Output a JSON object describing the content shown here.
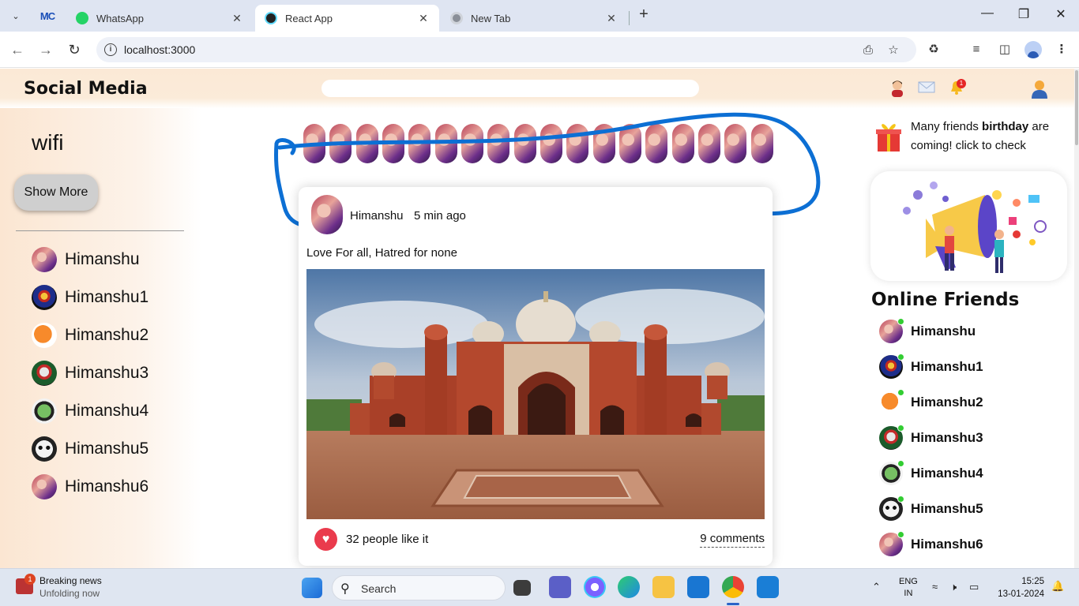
{
  "browser": {
    "tabs": [
      {
        "title": "WhatsApp",
        "active": false
      },
      {
        "title": "React App",
        "active": true
      },
      {
        "title": "New Tab",
        "active": false
      }
    ],
    "address": "localhost:3000"
  },
  "app": {
    "brand": "Social Media",
    "notification_count": "1",
    "left": {
      "heading": "wifi",
      "show_more": "Show More",
      "friends": [
        "Himanshu",
        "Himanshu1",
        "Himanshu2",
        "Himanshu3",
        "Himanshu4",
        "Himanshu5",
        "Himanshu6"
      ]
    },
    "post": {
      "author": "Himanshu",
      "time": "5 min ago",
      "caption": "Love For all, Hatred for none",
      "likes": "32 people like it",
      "comments": "9 comments"
    },
    "right": {
      "birthday_pre": "Many friends ",
      "birthday_bold": "birthday",
      "birthday_post": " are coming! click to check",
      "online_title": "Online Friends",
      "online": [
        "Himanshu",
        "Himanshu1",
        "Himanshu2",
        "Himanshu3",
        "Himanshu4",
        "Himanshu5",
        "Himanshu6"
      ]
    }
  },
  "taskbar": {
    "news_badge": "1",
    "news_title": "Breaking news",
    "news_sub": "Unfolding now",
    "search": "Search",
    "lang1": "ENG",
    "lang2": "IN",
    "time": "15:25",
    "date": "13-01-2024"
  },
  "colors": {
    "accent_blue": "#0c6fd4",
    "online_dot": "#32cd32",
    "like": "#ea3b4d"
  }
}
